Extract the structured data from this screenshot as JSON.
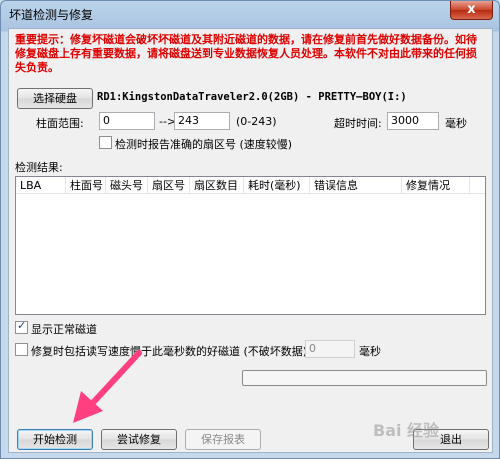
{
  "window": {
    "title": "坏道检测与修复",
    "close_label": "x"
  },
  "warning": {
    "text": "重要提示：修复坏磁道会破坏坏磁道及其附近磁道的数据，请在修复前首先做好数据备份。如待修复磁盘上存有重要数据，请将磁盘送到专业数据恢复人员处理。本软件不对由此带来的任何损失负责。"
  },
  "disk": {
    "select_button": "选择硬盘",
    "info": "RD1:KingstonDataTraveler2.0(2GB) - PRETTY—BOY(I:)"
  },
  "range": {
    "label": "柱面范围:",
    "from": "0",
    "arrow": "-->",
    "to": "243",
    "hint": "(0-243)",
    "timeout_label": "超时时间:",
    "timeout_value": "3000",
    "timeout_unit": "毫秒"
  },
  "options": {
    "report_sector": "检测时报告准确的扇区号 (速度较慢)",
    "report_sector_checked": false,
    "show_normal": "显示正常磁道",
    "show_normal_checked": true,
    "repair_slow": "修复时包括读写速度慢于此毫秒数的好磁道 (不破坏数据):",
    "repair_slow_checked": false,
    "slow_value": "0",
    "slow_unit": "毫秒"
  },
  "results": {
    "label": "检测结果:",
    "columns": [
      "LBA",
      "柱面号",
      "磁头号",
      "扇区号",
      "扇区数目",
      "耗时(毫秒)",
      "错误信息",
      "修复情况"
    ]
  },
  "buttons": {
    "start": "开始检测",
    "try_repair": "尝试修复",
    "save_report": "保存报表",
    "exit": "退出"
  },
  "watermark": "Bai 经验",
  "colors": {
    "warning": "#e00000",
    "arrow": "#ff3f7f"
  }
}
